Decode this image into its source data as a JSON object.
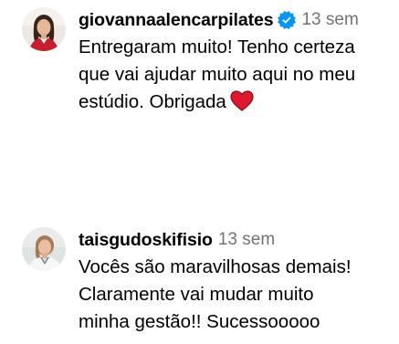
{
  "comments": [
    {
      "username": "giovannaalencarpilates",
      "verified": true,
      "time": "13 sem",
      "lines": [
        "Entregaram muito! Tenho certeza",
        "que vai ajudar muito aqui no meu",
        "estúdio. Obrigada"
      ],
      "emoji": "red-heart"
    },
    {
      "username": "taisgudoskifisio",
      "verified": false,
      "time": "13 sem",
      "lines": [
        "Vocês são maravilhosas demais!",
        "Claramente vai mudar muito",
        "minha gestão!! Sucessooooo"
      ]
    }
  ],
  "colors": {
    "text": "#000000",
    "timestamp": "#737373",
    "verified_badge": "#0095f6",
    "heart": "#e0182d"
  }
}
